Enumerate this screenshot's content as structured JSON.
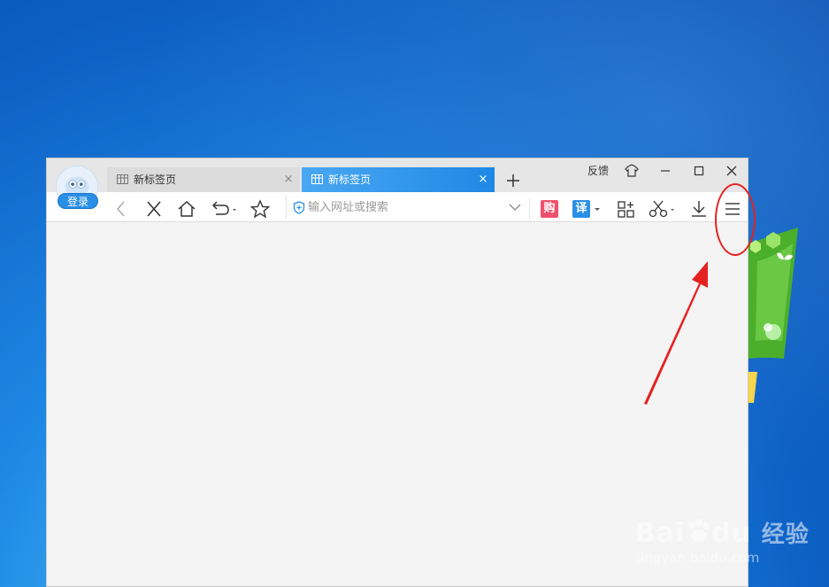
{
  "desktop": {
    "background_colors": [
      "#4fc3f7",
      "#1e88e5",
      "#0a4fb0"
    ],
    "logo_icon": "windows-7-logo-icon"
  },
  "browser": {
    "login_label": "登录",
    "avatar_icon": "owl-avatar-icon",
    "tabs": [
      {
        "title": "新标签页",
        "active": false,
        "icon": "grid-icon",
        "close": "×"
      },
      {
        "title": "新标签页",
        "active": true,
        "icon": "grid-icon",
        "close": "×"
      }
    ],
    "new_tab_icon": "plus-icon",
    "window_controls": {
      "feedback_label": "反馈",
      "skin_icon": "shirt-icon",
      "minimize_icon": "minimize-icon",
      "maximize_icon": "maximize-icon",
      "close_icon": "close-icon"
    },
    "toolbar": {
      "back_icon": "chevron-left-icon",
      "stop_icon": "close-icon",
      "home_icon": "home-icon",
      "undo_icon": "undo-icon",
      "favorite_icon": "star-icon",
      "address_placeholder": "输入网址或搜索",
      "address_value": "",
      "shield_icon": "shield-icon",
      "dropdown_icon": "chevron-down-icon",
      "shop_label": "购",
      "shop_color": "#f0506e",
      "translate_label": "译",
      "translate_color": "#2a8fe6",
      "apps_icon": "apps-icon",
      "screenshot_icon": "scissors-icon",
      "download_icon": "download-icon",
      "menu_icon": "hamburger-menu-icon"
    },
    "accent_color": "#1e88e5"
  },
  "annotation": {
    "color": "#e52222",
    "shape": "ellipse-around-menu-button",
    "arrow": "red-arrow-pointing-to-menu"
  },
  "watermark": {
    "brand": "Bai",
    "brand2": "du",
    "suffix": "经验",
    "url": "jingyan.baidu.com"
  }
}
